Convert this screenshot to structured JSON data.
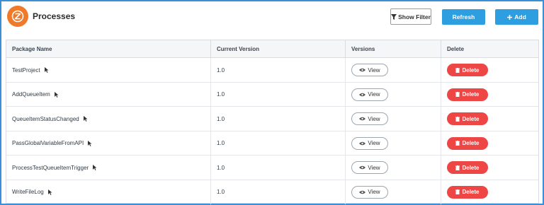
{
  "header": {
    "title": "Processes",
    "show_filter_label": "Show Filter",
    "refresh_label": "Refresh",
    "add_label": "Add"
  },
  "table": {
    "columns": [
      "Package Name",
      "Current Version",
      "Versions",
      "Delete"
    ],
    "view_label": "View",
    "delete_label": "Delete",
    "rows": [
      {
        "name": "TestProject",
        "version": "1.0"
      },
      {
        "name": "AddQueueItem",
        "version": "1.0"
      },
      {
        "name": "QueueItemStatusChanged",
        "version": "1.0"
      },
      {
        "name": "PassGlobalVariableFromAPI",
        "version": "1.0"
      },
      {
        "name": "ProcessTestQueueItemTrigger",
        "version": "1.0"
      },
      {
        "name": "WriteFileLog",
        "version": "1.0"
      }
    ]
  },
  "colors": {
    "accent": "#2d9fe0",
    "logo": "#f07a2a",
    "danger": "#ee4545",
    "frame_border": "#3b8fd6"
  },
  "icons": [
    "logo-icon",
    "filter-icon",
    "plus-icon",
    "pointer-cursor-icon",
    "eye-icon",
    "trash-icon"
  ]
}
